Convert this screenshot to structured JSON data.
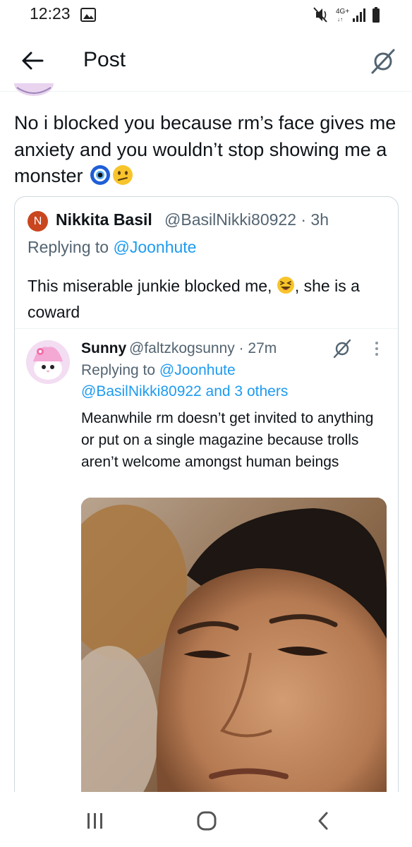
{
  "status_bar": {
    "time": "12:23",
    "network": "4G+",
    "icons": [
      "gallery-icon",
      "mute-icon",
      "signal-icon",
      "battery-icon"
    ]
  },
  "header": {
    "title": "Post",
    "back_icon": "arrow-left-icon",
    "action_icon": "grok-icon"
  },
  "tweet": {
    "text": "No i blocked you because rm’s face gives me anxiety and you wouldn’t stop showing me a monster",
    "emojis": [
      "nazar-amulet-emoji",
      "confused-face-emoji"
    ]
  },
  "quote": {
    "avatar_letter": "N",
    "name": "Nikkita Basil",
    "handle": "@BasilNikki80922 · 3h",
    "replying_label": "Replying to ",
    "replying_to": "@Joonhute",
    "body_before": "This miserable junkie blocked me, ",
    "body_after": ", she is a coward",
    "emoji": "grinning-squinting-face-emoji",
    "colors": {
      "avatar": "#c9461f"
    }
  },
  "inner_reply": {
    "name": "Sunny",
    "handle": "@faltzkogsunny · 27m",
    "replying_label": "Replying to ",
    "replying_to": "@Joonhute",
    "replying_more": "@BasilNikki80922 and 3 others",
    "body": "Meanwhile rm doesn’t get invited to anything or put on a single magazine because trolls aren’t welcome amongst human beings",
    "media": "close-up-photo-of-man"
  },
  "nav": {
    "icons": [
      "recent-apps-icon",
      "home-icon",
      "back-icon"
    ]
  },
  "colors": {
    "text": "#0f1419",
    "secondary": "#536471",
    "link": "#1d9bf0",
    "border": "#cfd9de"
  }
}
